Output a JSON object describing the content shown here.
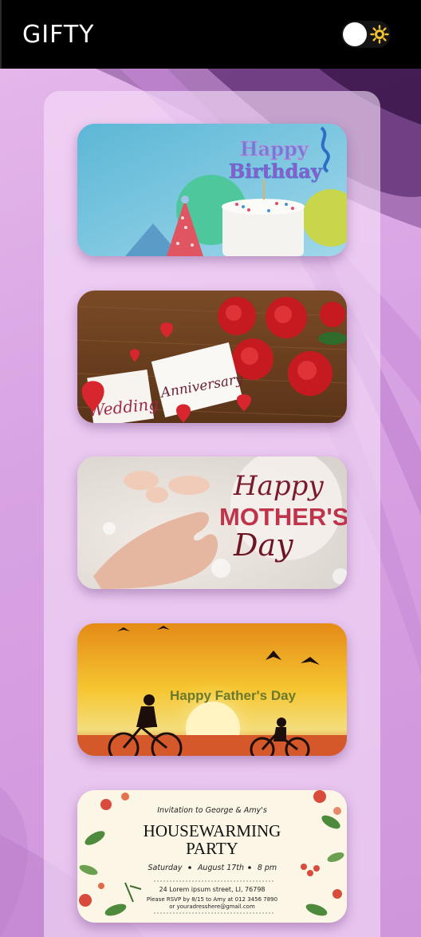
{
  "app": {
    "title": "GIFTY"
  },
  "theme_toggle": {
    "state": "light"
  },
  "cards": [
    {
      "name": "birthday-card",
      "line1": "Happy",
      "line2": "Birthday"
    },
    {
      "name": "anniversary-card",
      "line1": "Wedding",
      "line2": "Anniversary"
    },
    {
      "name": "mothers-day-card",
      "line1": "Happy",
      "line2": "MOTHER'S",
      "line3": "Day"
    },
    {
      "name": "fathers-day-card",
      "line1": "Happy Father's Day"
    },
    {
      "name": "housewarming-card",
      "invite": "Invitation to George & Amy's",
      "title1": "HOUSEWARMING",
      "title2": "PARTY",
      "day": "Saturday",
      "date": "August 17th",
      "time": "8 pm",
      "address": "24 Lorem ipsum street, LI, 76798",
      "rsvp": "Please RSVP by 8/15 to Amy at 012 3456 7890",
      "email": "or  youradresshere@gmail.com"
    }
  ],
  "colors": {
    "header_bg": "#000000",
    "background": "#d8a3e3",
    "panel": "#f5e1f8",
    "accent_sun": "#f2c230"
  }
}
